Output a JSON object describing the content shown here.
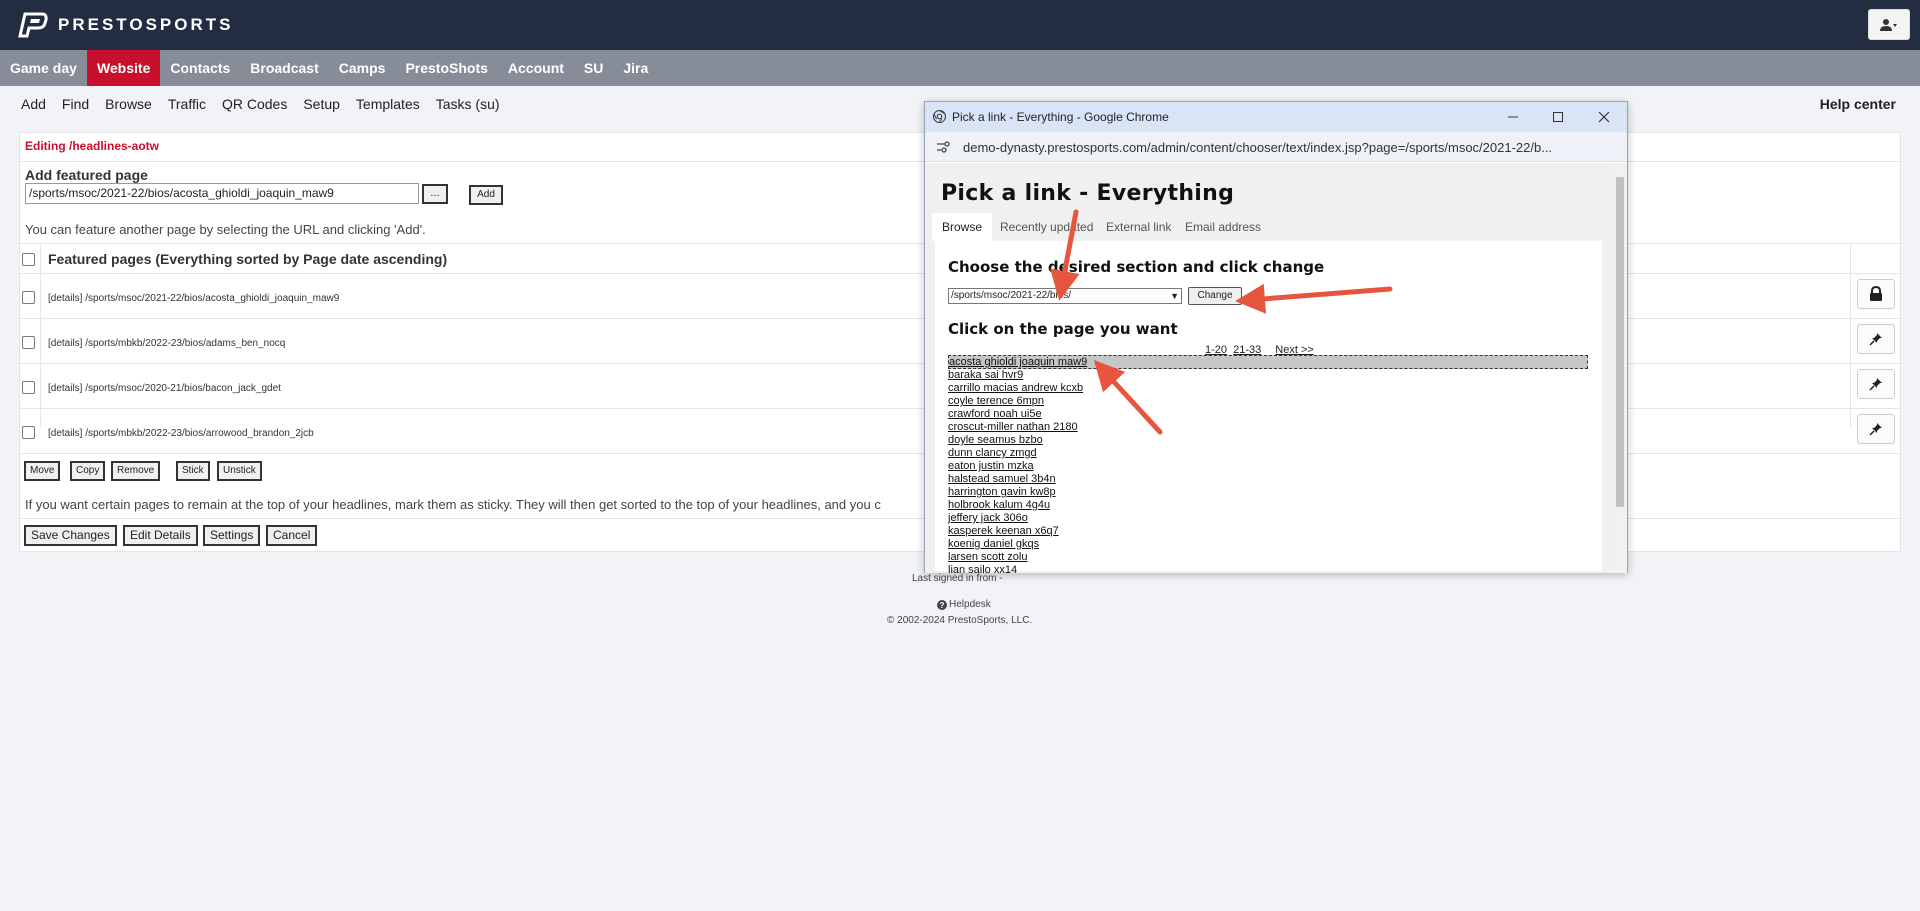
{
  "brand": {
    "name": "PRESTOSPORTS"
  },
  "main_nav": [
    "Game day",
    "Website",
    "Contacts",
    "Broadcast",
    "Camps",
    "PrestoShots",
    "Account",
    "SU",
    "Jira"
  ],
  "main_nav_active": "Website",
  "sub_nav": [
    "Add",
    "Find",
    "Browse",
    "Traffic",
    "QR Codes",
    "Setup",
    "Templates",
    "Tasks (su)"
  ],
  "help_center": "Help center",
  "editor": {
    "title": "Editing /headlines-aotw",
    "add_label": "Add featured page",
    "add_value": "/sports/msoc/2021-22/bios/acosta_ghioldi_joaquin_maw9",
    "dots_label": "...",
    "add_button": "Add",
    "feature_help": "You can feature another page by selecting the URL and clicking 'Add'.",
    "featured_header": "Featured pages (Everything sorted by Page date ascending)",
    "rows": [
      "[details] /sports/msoc/2021-22/bios/acosta_ghioldi_joaquin_maw9",
      "[details] /sports/mbkb/2022-23/bios/adams_ben_nocq",
      "[details] /sports/msoc/2020-21/bios/bacon_jack_gdet",
      "[details] /sports/mbkb/2022-23/bios/arrowood_brandon_2jcb"
    ],
    "row_buttons": [
      "Move",
      "Copy",
      "Remove",
      "Stick",
      "Unstick"
    ],
    "sticky_help": "If you want certain pages to remain at the top of your headlines, mark them as sticky. They will then get sorted to the top of your headlines, and you c",
    "bottom_buttons": [
      "Save Changes",
      "Edit Details",
      "Settings",
      "Cancel"
    ]
  },
  "footer": {
    "last_signed": "Last signed in from -",
    "helpdesk": "Helpdesk",
    "copyright": "© 2002-2024 PrestoSports, LLC."
  },
  "popup": {
    "window_title": "Pick a link - Everything - Google Chrome",
    "url": "demo-dynasty.prestosports.com/admin/content/chooser/text/index.jsp?page=/sports/msoc/2021-22/b...",
    "heading": "Pick a link - Everything",
    "tabs": [
      "Browse",
      "Recently updated",
      "External link",
      "Email address"
    ],
    "section_title": "Choose the desired section and click change",
    "section_value": "/sports/msoc/2021-22/bios/",
    "change_button": "Change",
    "page_title": "Click on the page you want",
    "pager": [
      "1-20",
      "21-33",
      "Next >>"
    ],
    "bios": [
      "acosta ghioldi joaquin maw9",
      "baraka sai hvr9",
      "carrillo macias andrew kcxb",
      "coyle terence 6mpn",
      "crawford noah ui5e",
      "croscut-miller nathan 2180",
      "doyle seamus bzbo",
      "dunn clancy zmgd",
      "eaton justin mzka",
      "halstead samuel 3b4n",
      "harrington gavin kw8p",
      "holbrook kalum 4g4u",
      "jeffery jack 306o",
      "kasperek keenan x6q7",
      "koenig daniel gkqs",
      "larsen scott zolu",
      "lian sailo xx14"
    ]
  },
  "colors": {
    "topbar": "#222d42",
    "accent": "#c8102e",
    "nav": "#868d98",
    "arrow": "#e8553f"
  }
}
